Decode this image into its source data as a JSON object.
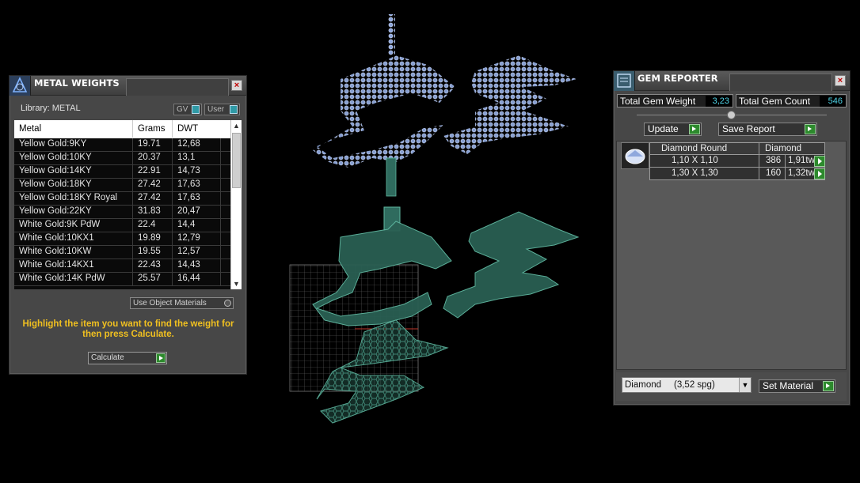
{
  "metal_weights": {
    "title": "METAL WEIGHTS",
    "library_label": "Library: METAL",
    "toggle_gv": "GV",
    "toggle_user": "User",
    "columns": [
      "Metal",
      "Grams",
      "DWT"
    ],
    "rows": [
      [
        "Yellow Gold:9KY",
        "19.71",
        "12,68"
      ],
      [
        "Yellow Gold:10KY",
        "20.37",
        "13,1"
      ],
      [
        "Yellow Gold:14KY",
        "22.91",
        "14,73"
      ],
      [
        "Yellow Gold:18KY",
        "27.42",
        "17,63"
      ],
      [
        "Yellow Gold:18KY Royal",
        "27.42",
        "17,63"
      ],
      [
        "Yellow Gold:22KY",
        "31.83",
        "20,47"
      ],
      [
        "White Gold:9K PdW",
        "22.4",
        "14,4"
      ],
      [
        "White Gold:10KX1",
        "19.89",
        "12,79"
      ],
      [
        "White Gold:10KW",
        "19.55",
        "12,57"
      ],
      [
        "White Gold:14KX1",
        "22.43",
        "14,43"
      ],
      [
        "White Gold:14K PdW",
        "25.57",
        "16,44"
      ]
    ],
    "use_object_materials": "Use Object Materials",
    "instructions": "Highlight the item you want to find the weight for then press Calculate.",
    "calculate_label": "Calculate"
  },
  "gem_reporter": {
    "title": "GEM REPORTER",
    "total_weight_label": "Total Gem Weight",
    "total_weight_value": "3,23",
    "total_count_label": "Total Gem Count",
    "total_count_value": "546",
    "update_label": "Update",
    "save_report_label": "Save Report",
    "table_header": [
      "Diamond Round",
      "Diamond"
    ],
    "rows": [
      [
        "1,10 X 1,10",
        "386",
        "1,91tw"
      ],
      [
        "1,30 X 1,30",
        "160",
        "1,32tw"
      ]
    ],
    "material_select": "Diamond     (3,52 spg)",
    "set_material_label": "Set Material"
  },
  "colors": {
    "panel_bg": "#474747",
    "accent_yellow": "#f0c020",
    "value_cyan": "#4fd5e8",
    "gem_blue": "#8fa8dd",
    "mesh_green": "#2f6b5e"
  },
  "viewport": {
    "objects": [
      "gem-pave-model",
      "metal-mesh-model",
      "reference-grid"
    ]
  }
}
